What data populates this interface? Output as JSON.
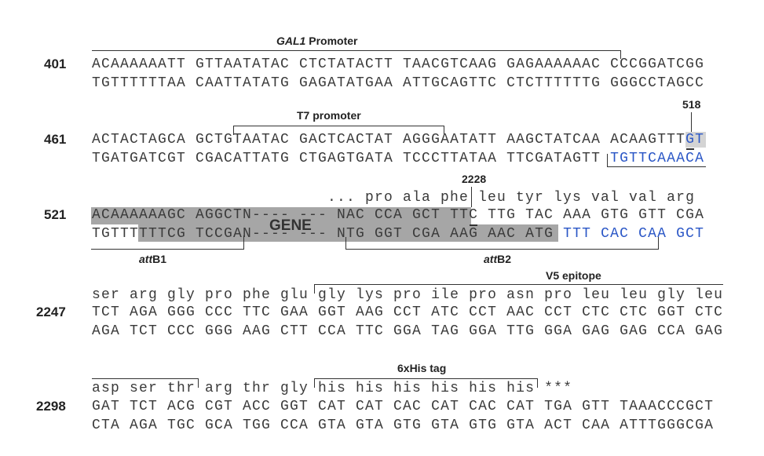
{
  "labels": {
    "gal1_italic": "GAL1",
    "gal1_rest": " Promoter",
    "t7": "T7 promoter",
    "pos518": "518",
    "pos2228": "2228",
    "attb1_italic": "att",
    "attb1_rest": "B1",
    "attb2_italic": "att",
    "attb2_rest": "B2",
    "v5": "V5 epitope",
    "his": "6xHis tag",
    "gene": "GENE"
  },
  "blocks": [
    {
      "number": "401",
      "top": "ACAAAAAATT GTTAATATAC CTCTATACTT TAACGTCAAG GAGAAAAAAC CCCGGATCGG",
      "bottom": "TGTTTTTTAA CAATTATATG GAGATATGAA ATTGCAGTTC CTCTTTTTTG GGGCCTAGCC"
    },
    {
      "number": "461",
      "top": "ACTACTAGCA GCTGTAATAC GACTCACTAT AGGGAATATT AAGCTATCAA ACAAGTTT",
      "top_blue": "GT",
      "bottom": "TGATGATCGT CGACATTATG CTGAGTGATA TCCCTTATAA TTCGATAGTT ",
      "bottom_blue": "TGTTCAAACA"
    },
    {
      "number": "521",
      "aa": "... pro ala phe leu tyr lys val val arg",
      "top": "ACAAAAAAGC AGGCTN---- --- NAC CCA GCT TTC TTG TAC AAA GTG GTT CGA",
      "bottom": "TGTTTTTTCG TCCGAN---- --- NTG GGT CGA AAG AAC ATG ",
      "bottom_blue": "TTT CAC CAA GCT"
    },
    {
      "number": "2247",
      "aa": "ser arg gly pro phe glu gly lys pro ile pro asn pro leu leu gly leu",
      "top": "TCT AGA GGG CCC TTC GAA GGT AAG CCT ATC CCT AAC CCT CTC CTC GGT CTC",
      "bottom": "AGA TCT CCC GGG AAG CTT CCA TTC GGA TAG GGA TTG GGA GAG GAG CCA GAG"
    },
    {
      "number": "2298",
      "aa": "asp ser thr arg thr gly his his his his his his ***",
      "top": "GAT TCT ACG CGT ACC GGT CAT CAT CAC CAT CAC CAT TGA GTT TAAACCCGCT",
      "bottom": "CTA AGA TGC GCA TGG CCA GTA GTA GTG GTA GTG GTA ACT CAA ATTTGGGCGA"
    }
  ],
  "colors": {
    "highlight": "#a6a6a6",
    "text": "#3a3a3a",
    "accent": "#2a56c6"
  }
}
